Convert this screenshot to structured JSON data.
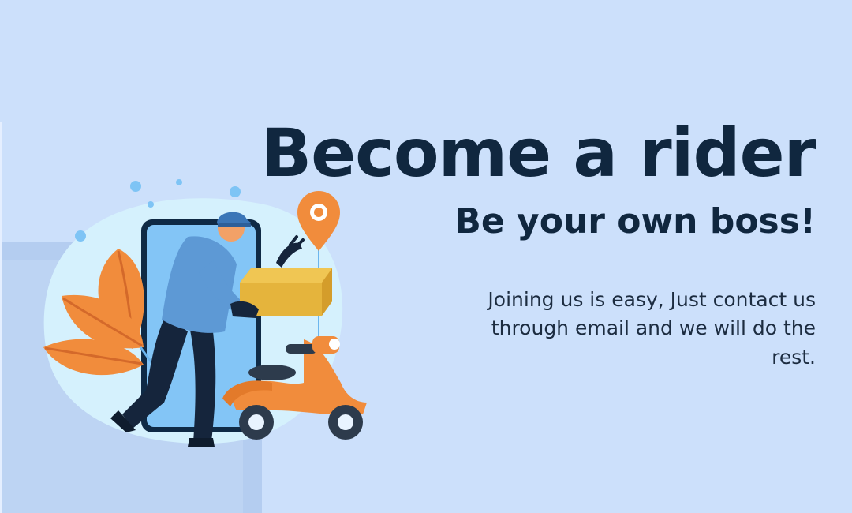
{
  "hero": {
    "headline": "Become a rider",
    "subheadline": "Be your own boss!",
    "body": "Joining us is easy, Just contact us through email and we will do the rest."
  },
  "colors": {
    "background": "#cce0fb",
    "heading": "#10273f",
    "accent_orange": "#f18c3c",
    "phone_blue": "#7ec4f5",
    "box_yellow": "#e5b43c"
  },
  "icons": [
    "location-pin-icon",
    "phone",
    "delivery-rider",
    "scooter",
    "leaf"
  ]
}
